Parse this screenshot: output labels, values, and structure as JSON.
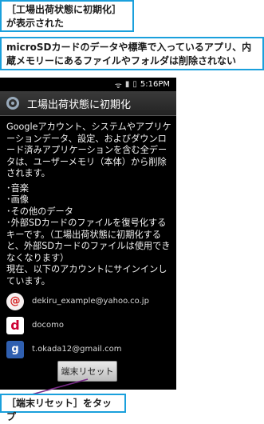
{
  "callouts": {
    "top": "［工場出荷状態に初期化］が表示された",
    "middle": "microSDカードのデータや標準で入っているアプリ、内蔵メモリーにあるファイルやフォルダは削除されない",
    "bottom": "［端末リセット］をタップ"
  },
  "statusbar": {
    "time": "5:16PM",
    "icons": [
      "wifi-icon",
      "signal-icon",
      "battery-icon"
    ]
  },
  "screen": {
    "title": "工場出荷状態に初期化",
    "description": "Googleアカウント、システムやアプリケーションデータ、設定、およびダウンロード済みアプリケーションを含む全データは、ユーザーメモリ（本体）から削除されます。",
    "bullets": [
      "･音楽",
      "･画像",
      "･その他のデータ"
    ],
    "sd_note": "･外部SDカードのファイルを復号化するキーです。（工場出荷状態に初期化すると、外部SDカードのファイルは使用できなくなります）",
    "signed_in_text": "現在、以下のアカウントにサインインしています。",
    "accounts": [
      {
        "label": "dekiru_example@yahoo.co.jp",
        "icon": "yahoo-mail-icon"
      },
      {
        "label": "docomo",
        "icon": "docomo-icon"
      },
      {
        "label": "t.okada12@gmail.com",
        "icon": "google-icon"
      }
    ],
    "reset_button": "端末リセット"
  },
  "colors": {
    "callout_border": "#1aa0dc",
    "leader_line": "#7a2a8a"
  }
}
